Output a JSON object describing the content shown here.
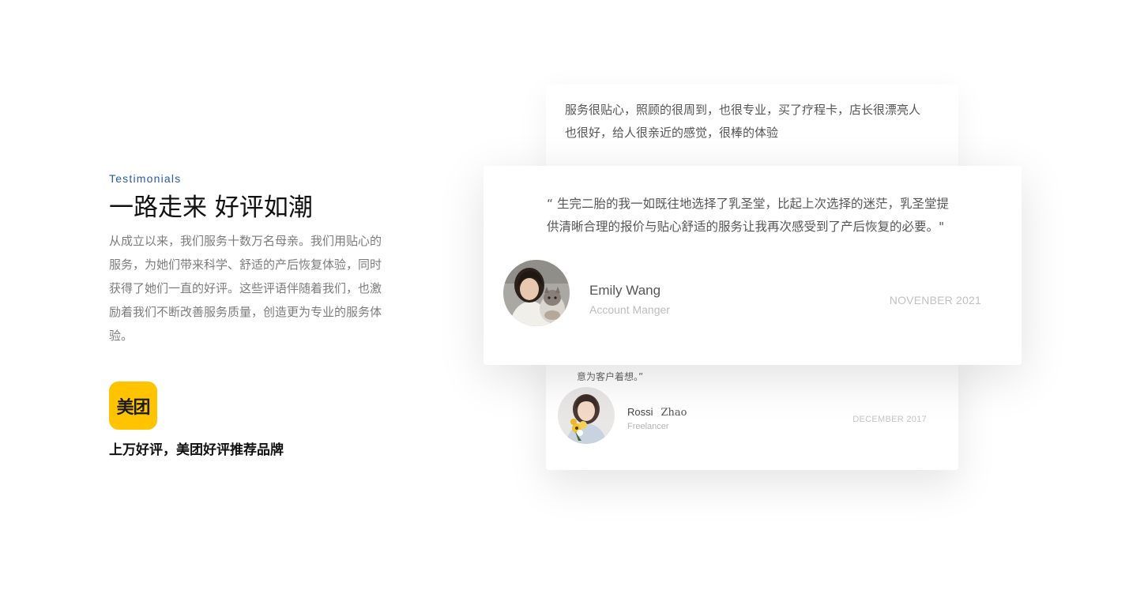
{
  "left": {
    "kicker": "Testimonials",
    "title": "一路走来 好评如潮",
    "description": "从成立以来，我们服务十数万名母亲。我们用贴心的服务，为她们带来科学、舒适的产后恢复体验，同时获得了她们一直的好评。这些评语伴随着我们，也激励着我们不断改善服务质量，创造更为专业的服务体验。",
    "brand_logo_text": "美团",
    "brand_caption": "上万好评，美团好评推荐品牌"
  },
  "testimonials": {
    "back_top": {
      "quote": "服务很贴心，照顾的很周到，也很专业，买了疗程卡，店长很漂亮人也很好，给人很亲近的感觉，很棒的体验"
    },
    "front": {
      "quote": "“ 生完二胎的我一如既往地选择了乳圣堂，比起上次选择的迷茫，乳圣堂提供清晰合理的报价与贴心舒适的服务让我再次感受到了产后恢复的必要。\"",
      "name": "Emily Wang",
      "role": "Account Manger",
      "date": "NOVENBER 2021"
    },
    "back_bottom": {
      "quote_tail": "意为客户着想。”",
      "first_name": "Rossi",
      "last_name": "Zhao",
      "role": "Freelancer",
      "date": "DECEMBER 2017"
    }
  },
  "colors": {
    "kicker": "#2b5aa6",
    "brand": "#ffc300"
  },
  "icons": {
    "brand_logo": "meituan-logo",
    "avatar_front": "avatar-woman-with-cat",
    "avatar_bottom": "avatar-girl-with-flowers"
  }
}
